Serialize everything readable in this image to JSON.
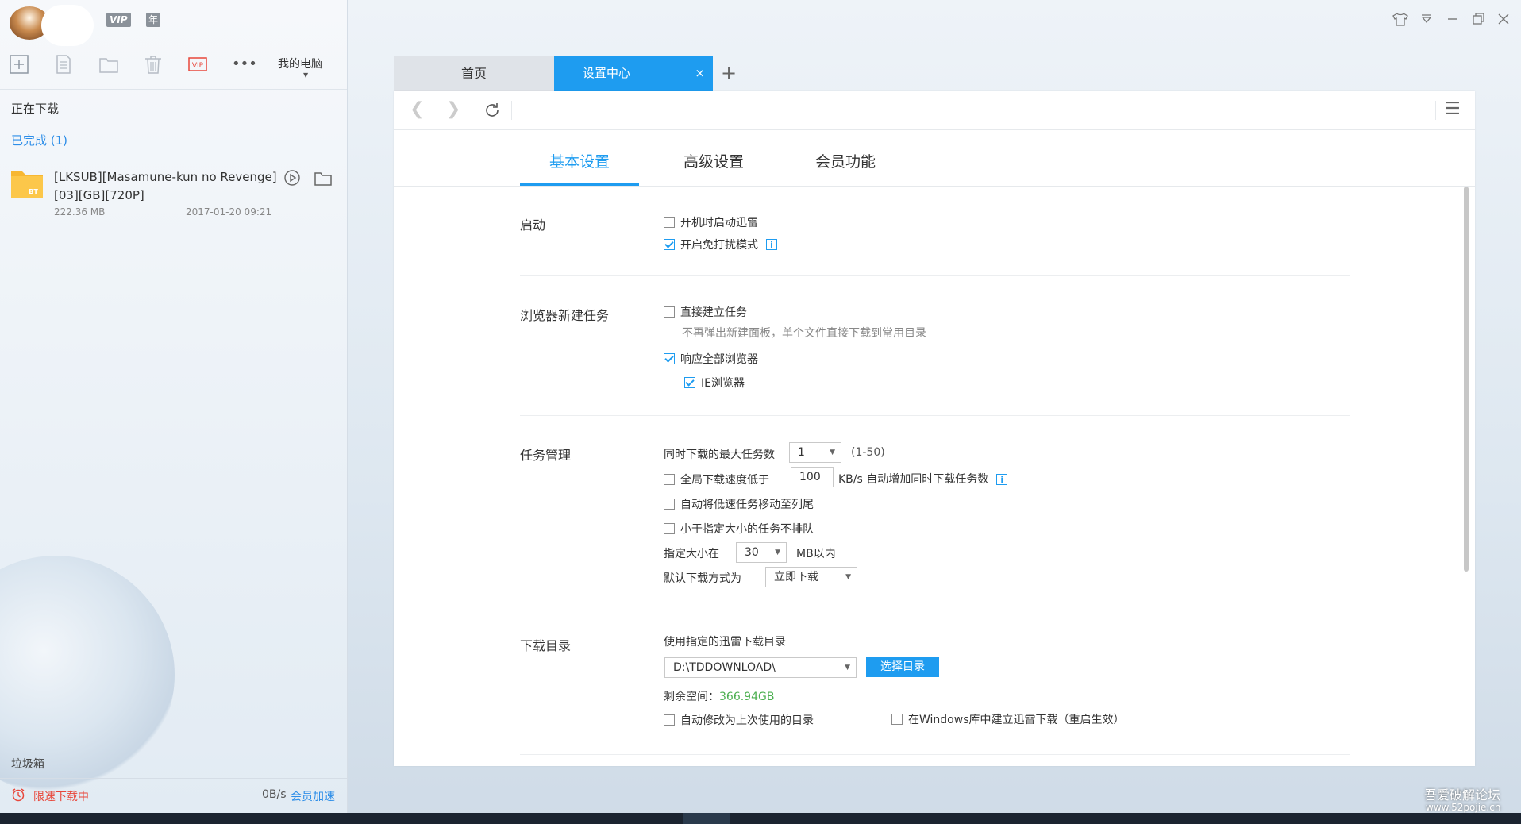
{
  "user": {
    "vip_badge": "VIP",
    "year_badge": "年"
  },
  "toolbar": {
    "icons": [
      "new-task-icon",
      "file-icon",
      "folder-icon",
      "trash-icon",
      "vip-icon",
      "more-icon"
    ],
    "vip_label": "VIP",
    "more_label": "•••",
    "my_pc": "我的电脑"
  },
  "left": {
    "downloading": "正在下载",
    "completed": "已完成 (1)",
    "file": {
      "badge": "BT",
      "name": "[LKSUB][Masamune-kun no Revenge][03][GB][720P]",
      "size": "222.36 MB",
      "date": "2017-01-20 09:21"
    },
    "trash": "垃圾箱",
    "speed_limit": "限速下载中",
    "speed": "0B/s",
    "boost": "会员加速"
  },
  "tabs": {
    "home": "首页",
    "settings": "设置中心",
    "close": "×",
    "add": "+"
  },
  "settings_tabs": [
    "基本设置",
    "高级设置",
    "会员功能"
  ],
  "groups": {
    "startup": {
      "label": "启动",
      "boot_launch": "开机时启动迅雷",
      "boot_launch_checked": false,
      "dnd_mode": "开启免打扰模式",
      "dnd_mode_checked": true
    },
    "browser": {
      "label": "浏览器新建任务",
      "direct_create": "直接建立任务",
      "direct_create_checked": false,
      "direct_create_hint": "不再弹出新建面板，单个文件直接下载到常用目录",
      "all_browsers": "响应全部浏览器",
      "all_browsers_checked": true,
      "ie": "IE浏览器",
      "ie_checked": true
    },
    "tasks": {
      "label": "任务管理",
      "max_tasks_label": "同时下载的最大任务数",
      "max_tasks_value": "1",
      "max_tasks_range": "(1-50)",
      "speed_below_label": "全局下载速度低于",
      "speed_below_checked": false,
      "speed_below_value": "100",
      "speed_below_suffix": "KB/s 自动增加同时下载任务数",
      "move_slow": "自动将低速任务移动至列尾",
      "move_slow_checked": false,
      "small_no_queue": "小于指定大小的任务不排队",
      "small_no_queue_checked": false,
      "size_label": "指定大小在",
      "size_value": "30",
      "size_unit": "MB以内",
      "default_mode_label": "默认下载方式为",
      "default_mode_value": "立即下载"
    },
    "directory": {
      "label": "下载目录",
      "use_dir_label": "使用指定的迅雷下载目录",
      "dir_value": "D:\\TDDOWNLOAD\\",
      "choose_button": "选择目录",
      "free_space_label": "剩余空间：",
      "free_space_value": "366.94GB",
      "auto_last_dir": "自动修改为上次使用的目录",
      "auto_last_dir_checked": false,
      "windows_library": "在Windows库中建立迅雷下载（重启生效）",
      "windows_library_checked": false
    }
  },
  "watermark": {
    "line1": "吾爱破解论坛",
    "line2": "www.52pojie.cn"
  },
  "colors": {
    "accent": "#1e9cf0",
    "warning": "#e8473b",
    "free_space": "#4caf50"
  }
}
